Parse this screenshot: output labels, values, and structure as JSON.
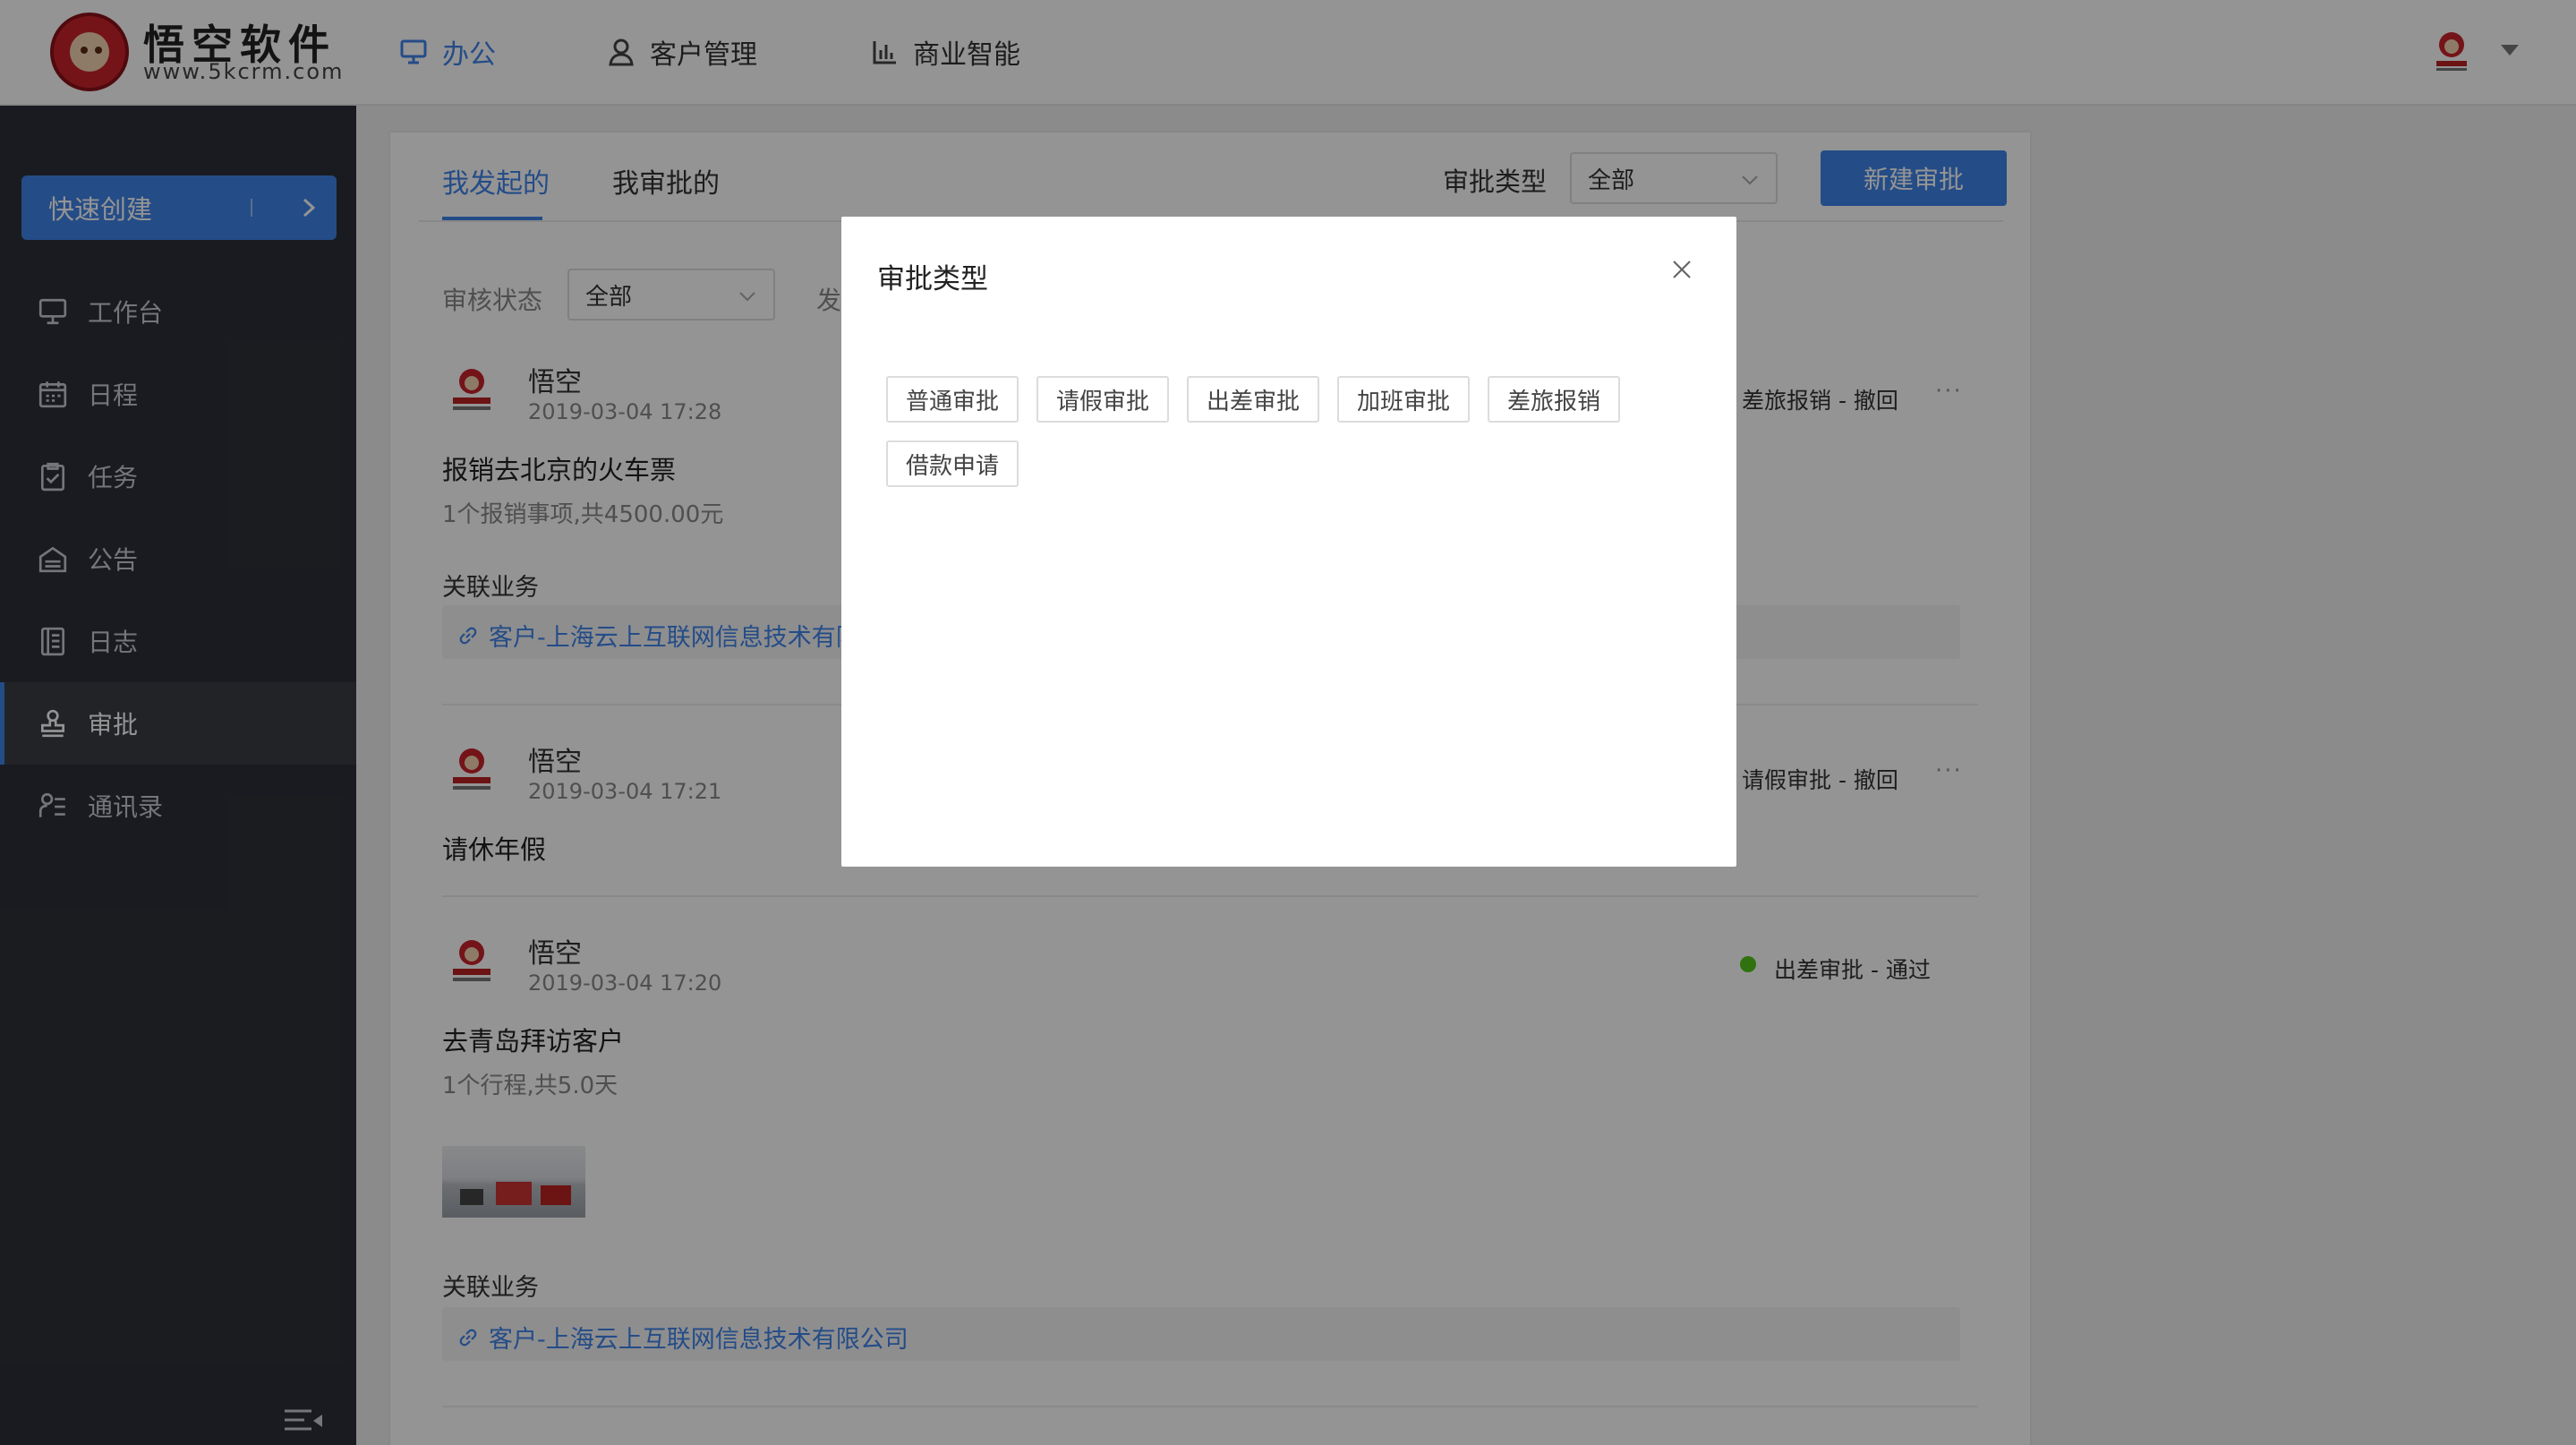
{
  "header": {
    "logo_title": "悟空软件",
    "logo_url": "www.5kcrm.com",
    "nav": [
      {
        "label": "办公",
        "icon": "monitor-icon",
        "active": true
      },
      {
        "label": "客户管理",
        "icon": "user-icon"
      },
      {
        "label": "商业智能",
        "icon": "bar-chart-icon"
      }
    ],
    "accent_color": "#3e84e9"
  },
  "sidebar": {
    "quick_create": "快速创建",
    "items": [
      {
        "label": "工作台",
        "icon": "monitor-icon"
      },
      {
        "label": "日程",
        "icon": "calendar-icon"
      },
      {
        "label": "任务",
        "icon": "task-icon"
      },
      {
        "label": "公告",
        "icon": "notice-icon"
      },
      {
        "label": "日志",
        "icon": "log-icon"
      },
      {
        "label": "审批",
        "icon": "stamp-icon",
        "active": true
      },
      {
        "label": "通讯录",
        "icon": "contacts-icon"
      }
    ]
  },
  "main": {
    "tabs": [
      {
        "label": "我发起的",
        "active": true
      },
      {
        "label": "我审批的"
      }
    ],
    "type_filter_label": "审批类型",
    "type_filter_value": "全部",
    "new_button": "新建审批",
    "status_filter_label": "审核状态",
    "status_filter_value": "全部",
    "filter_cut_text": "发",
    "records": [
      {
        "user": "悟空",
        "time": "2019-03-04 17:28",
        "title": "报销去北京的火车票",
        "subtitle": "1个报销事项,共4500.00元",
        "status": "差旅报销 - 撤回",
        "related_label": "关联业务",
        "related_link": "客户-上海云上互联网信息技术有限"
      },
      {
        "user": "悟空",
        "time": "2019-03-04 17:21",
        "title": "请休年假",
        "status": "请假审批 - 撤回"
      },
      {
        "user": "悟空",
        "time": "2019-03-04 17:20",
        "title": "去青岛拜访客户",
        "subtitle": "1个行程,共5.0天",
        "status": "出差审批 - 通过",
        "status_color": "#52c41a",
        "related_label": "关联业务",
        "related_link": "客户-上海云上互联网信息技术有限公司"
      }
    ],
    "more_glyph": "···"
  },
  "modal": {
    "title": "审批类型",
    "types": [
      "普通审批",
      "请假审批",
      "出差审批",
      "加班审批",
      "差旅报销",
      "借款申请"
    ]
  }
}
